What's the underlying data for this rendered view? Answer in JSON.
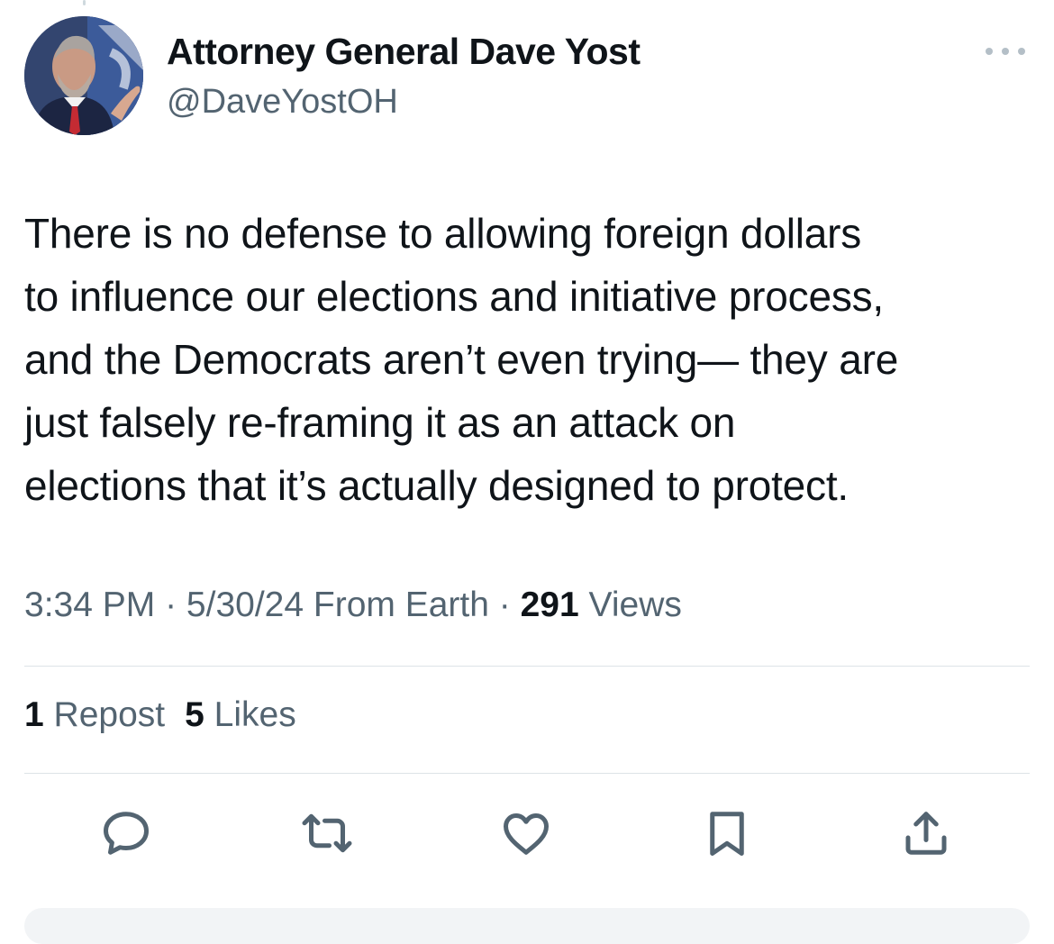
{
  "author": {
    "display_name": "Attorney General Dave Yost",
    "handle": "@DaveYostOH",
    "avatar_icon": "profile-photo"
  },
  "tweet": {
    "lines": [
      "There is no defense to allowing foreign dollars",
      "to influence our elections and initiative process,",
      "and the Democrats aren’t even trying— they are",
      "just falsely re-framing it as an attack on",
      "elections that it’s actually designed to protect."
    ]
  },
  "meta": {
    "time": "3:34 PM",
    "separator": " · ",
    "date": "5/30/24",
    "source": "From Earth",
    "views_count": "291",
    "views_label": "Views"
  },
  "stats": {
    "reposts_count": "1",
    "reposts_label": "Repost",
    "likes_count": "5",
    "likes_label": "Likes"
  },
  "actions": [
    {
      "name": "reply",
      "icon": "speech-bubble-icon"
    },
    {
      "name": "repost",
      "icon": "repost-arrows-icon"
    },
    {
      "name": "like",
      "icon": "heart-icon"
    },
    {
      "name": "bookmark",
      "icon": "bookmark-icon"
    },
    {
      "name": "share",
      "icon": "share-upload-icon"
    }
  ],
  "colors": {
    "text_primary": "#0f1419",
    "text_secondary": "#536471",
    "divider": "#dde3e7",
    "background": "#ffffff"
  }
}
